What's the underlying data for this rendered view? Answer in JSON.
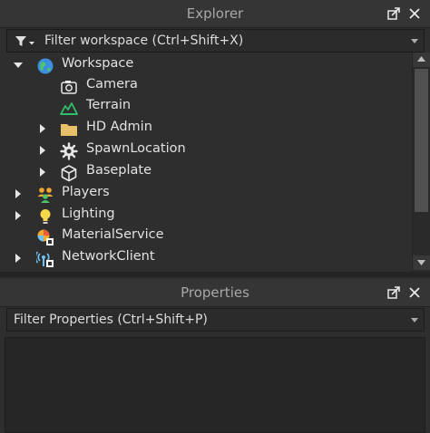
{
  "explorer": {
    "title": "Explorer",
    "filter_placeholder": "Filter workspace (Ctrl+Shift+X)",
    "tree": [
      {
        "label": "Workspace",
        "icon": "workspace-globe-icon",
        "expanded": true,
        "depth": 0
      },
      {
        "label": "Camera",
        "icon": "camera-icon",
        "depth": 1
      },
      {
        "label": "Terrain",
        "icon": "terrain-icon",
        "depth": 1
      },
      {
        "label": "HD Admin",
        "icon": "folder-icon",
        "depth": 1,
        "collapsed": true
      },
      {
        "label": "SpawnLocation",
        "icon": "spawn-gear-icon",
        "depth": 1,
        "collapsed": true
      },
      {
        "label": "Baseplate",
        "icon": "part-cube-icon",
        "depth": 1,
        "collapsed": true
      },
      {
        "label": "Players",
        "icon": "players-icon",
        "depth": 0,
        "collapsed": true
      },
      {
        "label": "Lighting",
        "icon": "lightbulb-icon",
        "depth": 0,
        "collapsed": true
      },
      {
        "label": "MaterialService",
        "icon": "material-service-icon",
        "depth": 0
      },
      {
        "label": "NetworkClient",
        "icon": "network-client-icon",
        "depth": 0,
        "collapsed": true
      }
    ]
  },
  "properties": {
    "title": "Properties",
    "filter_placeholder": "Filter Properties (Ctrl+Shift+P)"
  },
  "colors": {
    "background": "#2e2e2e",
    "header": "#353535",
    "text": "#e2e2e2",
    "folder": "#e8c06a",
    "terrain": "#2fbf6b",
    "lighting": "#f5d84a"
  }
}
